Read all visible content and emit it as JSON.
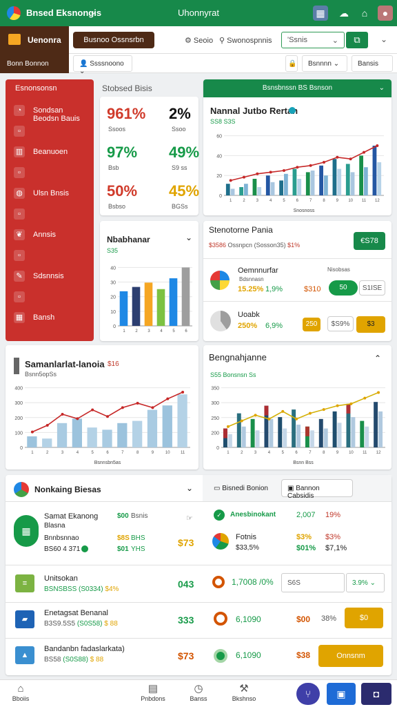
{
  "app": {
    "title": "Bnsed Eksnongis",
    "center_title": "Uhonnyrat"
  },
  "row2": {
    "brand": "Uenonra",
    "brand_sub": "Bonn Bonnon",
    "pill": "Busnoo Ossnsrbn",
    "link1": "Seoio",
    "link2": "Swonospnnis",
    "select_value": "'Ssnis"
  },
  "row3": {
    "dd1": "Ssssnoono",
    "dd2": "Bsnnnn",
    "dd3": "Bansis"
  },
  "sidebar": {
    "title": "Esnonsonsn",
    "items": [
      {
        "icon": "pie-icon",
        "label": "Sondsan Beodsn Bauis"
      },
      {
        "icon": "square-icon",
        "label": ""
      },
      {
        "icon": "doc-icon",
        "label": "Beanuoen"
      },
      {
        "icon": "square-icon",
        "label": ""
      },
      {
        "icon": "globe-icon",
        "label": "Ulsn Bnsis"
      },
      {
        "icon": "square-icon",
        "label": ""
      },
      {
        "icon": "leaf-icon",
        "label": "Annsis"
      },
      {
        "icon": "square-icon",
        "label": ""
      },
      {
        "icon": "edit-icon",
        "label": "Sdsnnsis"
      },
      {
        "icon": "square-icon",
        "label": ""
      },
      {
        "icon": "grid-icon",
        "label": "Bansh"
      }
    ]
  },
  "kpi": {
    "section_title": "Stobsed Bisis",
    "rows": [
      {
        "a": "961%",
        "a_color": "#d03a2a",
        "a_sub": "Ssoos",
        "b": "2%",
        "b_color": "#111",
        "b_sub": "Ssoo"
      },
      {
        "a": "97%",
        "a_color": "#169a48",
        "a_sub": "Bsb",
        "b": "49%",
        "b_color": "#169a48",
        "b_sub": "S9 ss"
      },
      {
        "a": "50%",
        "a_color": "#d03a2a",
        "a_sub": "Bsbso",
        "b": "45%",
        "b_color": "#e0a400",
        "b_sub": "BGSs"
      }
    ]
  },
  "chart1": {
    "header": "Bsnsbnssn  BS  Bsnson",
    "title": "Nannal Jutbo Rertan",
    "subtitle": "SS8  S3S",
    "xlabel": "Snosnoss"
  },
  "chart_data": [
    {
      "type": "bar",
      "title": "Nannal Jutbo Rertan",
      "categories": [
        "1",
        "2",
        "3",
        "4",
        "5",
        "6",
        "7",
        "8",
        "9",
        "10",
        "11",
        "12"
      ],
      "series": [
        {
          "values": [
            14,
            10,
            20,
            24,
            18,
            32,
            28,
            36,
            44,
            38,
            48,
            60
          ]
        },
        {
          "values": [
            8,
            14,
            10,
            16,
            26,
            20,
            30,
            24,
            32,
            28,
            34,
            40
          ]
        }
      ],
      "line": [
        18,
        22,
        26,
        28,
        30,
        34,
        36,
        40,
        46,
        44,
        52,
        60
      ],
      "ylim": [
        0,
        80
      ],
      "yticks": [
        "0",
        "20",
        "40",
        "60"
      ]
    },
    {
      "type": "bar",
      "title": "Nbabhanar",
      "categories": [
        "1",
        "2",
        "3",
        "4",
        "5",
        "6"
      ],
      "values": [
        32,
        36,
        40,
        34,
        44,
        54
      ],
      "ylim": [
        0,
        60
      ],
      "yticks": [
        "0",
        "10",
        "20",
        "30",
        "40"
      ]
    },
    {
      "type": "bar",
      "title": "Samanlarlat-lanoia",
      "categories": [
        "1",
        "2",
        "3",
        "4",
        "5",
        "6",
        "7",
        "8",
        "9",
        "10",
        "11"
      ],
      "values": [
        10,
        8,
        22,
        26,
        18,
        16,
        22,
        24,
        34,
        38,
        48
      ],
      "line": [
        14,
        20,
        30,
        26,
        34,
        28,
        36,
        40,
        36,
        44,
        50
      ],
      "ylim": [
        0,
        60
      ],
      "yticks": [
        "0",
        "100",
        "200",
        "300",
        "400"
      ]
    },
    {
      "type": "bar",
      "title": "Bengnahjanne",
      "categories": [
        "1",
        "2",
        "3",
        "4",
        "5",
        "6",
        "7",
        "8",
        "9",
        "10",
        "11",
        "12"
      ],
      "series": [
        {
          "values": [
            20,
            36,
            30,
            44,
            32,
            40,
            22,
            30,
            38,
            46,
            28,
            48
          ]
        },
        {
          "values": [
            14,
            22,
            18,
            30,
            20,
            24,
            18,
            20,
            26,
            32,
            22,
            38
          ]
        }
      ],
      "line": [
        22,
        28,
        34,
        30,
        38,
        30,
        36,
        40,
        44,
        46,
        52,
        58
      ],
      "ylim": [
        0,
        70
      ],
      "yticks": [
        "0",
        "200",
        "250",
        "300",
        "350"
      ]
    }
  ],
  "nbab": {
    "title": "Nbabhanar",
    "subtitle": "S35"
  },
  "summary": {
    "title": "Stenotorne Pania",
    "pill": "€S78",
    "line1": "$3586",
    "line2": "Ossnpcn",
    "line3": "(Sosson35)",
    "line4": "$1%",
    "items": [
      {
        "name": "Oemnnurfar",
        "sub": "Bdsnnasn",
        "v1": "15.25%",
        "v2": "1,9%",
        "v3": "$310",
        "btn": "50",
        "btn2": "S1ISE",
        "extra": "Nisobsas"
      },
      {
        "name": "Uoabk",
        "sub": "",
        "v1": "250%",
        "v2": "6,9%",
        "v3": "",
        "btn": "250",
        "btn2": "$S9%",
        "btn3": "$3"
      }
    ]
  },
  "sam": {
    "title": "Samanlarlat-lanoia",
    "tag": "$16",
    "sub": "Bsnn5opSs",
    "xlabel": "Bsnnsbn5as"
  },
  "beng": {
    "title": "Bengnahjanne",
    "sub": "S55  Bonsnsn  Ss",
    "xlabel": "Bsnn  Bss"
  },
  "bottom": {
    "title": "Nonkaing Biesas",
    "tab1": "Bisnedi Bonion",
    "tab2": "Bannon Cabsidis",
    "rows": [
      {
        "icon": "calc-icon",
        "name": "Samat Ekanong",
        "sub": "Blasna",
        "sub2": "Bnnbsnnao",
        "sub3": "BS60 4 371",
        "c1": "$00",
        "c2": "Bsnis",
        "c3": "$8S",
        "c4": "BHS",
        "c5": "$01",
        "c6": "YHS",
        "v": "$73"
      },
      {
        "icon": "clipboard-icon",
        "name": "Unitsokan",
        "sub": "BSNSBSS",
        "sub2": "(S0334)",
        "sub3": "$4%",
        "v": "043"
      },
      {
        "icon": "box-icon",
        "name": "Enetagsat Benanal",
        "sub": "B3S9.5S5",
        "sub2": "(S0S58)",
        "sub3": "$ 88",
        "v": "333"
      },
      {
        "icon": "box2-icon",
        "name": "Bandanbn fadaslarkata)",
        "sub": "BS58",
        "sub2": "(S0S88)",
        "sub3": "$ 88",
        "v": "$73"
      }
    ],
    "right": [
      {
        "label": "Anesbinokant",
        "v1": "2,007",
        "v2": "19%"
      },
      {
        "label": "Fotnis",
        "sub": "$33,5%",
        "v1": "$3%",
        "v2": "$3%",
        "v3": "$01%",
        "v4": "$7,1%"
      },
      {
        "label": "1,7008",
        "sub": "/0%",
        "f1": "S6S",
        "f2": "3.9%"
      },
      {
        "label": "6,1090",
        "v": "$00",
        "v2": "38%",
        "btn": "$0"
      },
      {
        "label": "6,1090",
        "v": "$38",
        "btn": "Onnsnm"
      }
    ]
  },
  "nav": {
    "items": [
      "Bboiis",
      "Pnbdons",
      "Banss",
      "Bkshnso",
      "",
      ""
    ]
  }
}
